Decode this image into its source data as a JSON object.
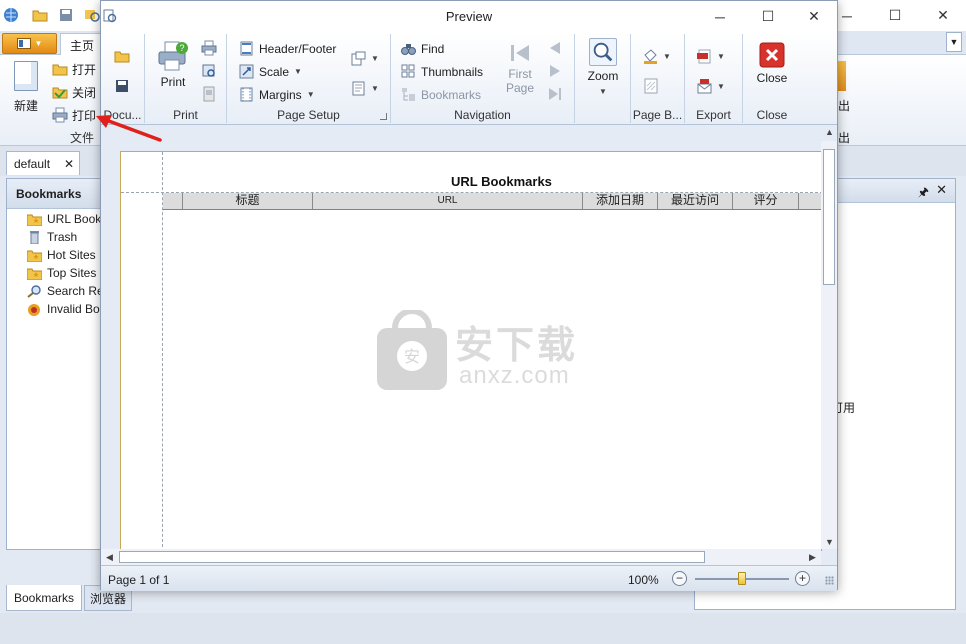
{
  "app": {
    "tabs": {
      "home": "主页"
    },
    "ribbon": {
      "new_label": "新建",
      "open_label": "打开",
      "close_label": "关闭",
      "print_label": "打印",
      "group_file": "文件",
      "right_label1": "出",
      "right_label2": "出"
    },
    "doc_tab": {
      "label": "default",
      "close": "✕"
    },
    "left_pane": {
      "title": "Bookmarks",
      "items": [
        {
          "label": "URL Bookmarks",
          "icon": "folder-star-icon"
        },
        {
          "label": "Trash",
          "icon": "trash-icon"
        },
        {
          "label": "Hot Sites",
          "icon": "folder-star-icon"
        },
        {
          "label": "Top Sites",
          "icon": "folder-star-icon"
        },
        {
          "label": "Search Results",
          "icon": "search-folder-icon"
        },
        {
          "label": "Invalid Bookmarks",
          "icon": "invalid-bookmark-icon"
        }
      ]
    },
    "bottom_tabs": [
      "Bookmarks",
      "浏览器"
    ],
    "right_pane": {
      "pin": "🖈",
      "close": "✕",
      "note": "可用"
    },
    "colors": {
      "accent": "#f0a020",
      "frame": "#9fb2cc"
    }
  },
  "preview": {
    "title": "Preview",
    "groups": {
      "document": "Docu...",
      "print": "Print",
      "page_setup": "Page Setup",
      "navigation": "Navigation",
      "page_background": "Page B...",
      "export": "Export",
      "close": "Close"
    },
    "buttons": {
      "print": "Print",
      "header_footer": "Header/Footer",
      "scale": "Scale",
      "margins": "Margins",
      "find": "Find",
      "thumbnails": "Thumbnails",
      "bookmarks": "Bookmarks",
      "first_page": "First Page",
      "zoom": "Zoom",
      "close": "Close"
    },
    "report": {
      "title": "URL Bookmarks",
      "columns": [
        "",
        "标题",
        "URL",
        "添加日期",
        "最近访问",
        "评分",
        ""
      ]
    },
    "watermark": {
      "cn": "安下载",
      "en": "anxz.com"
    },
    "status": {
      "page_info": "Page 1 of 1",
      "zoom": "100%",
      "zoom_level": 0.5
    }
  }
}
